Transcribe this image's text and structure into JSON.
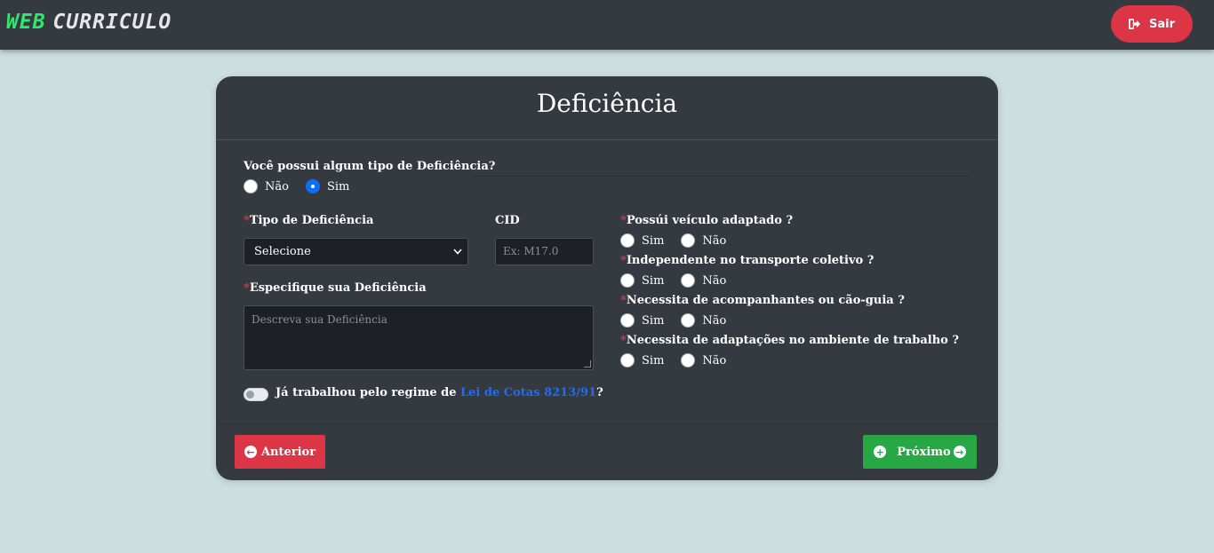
{
  "app": {
    "brand_part1": "WEB",
    "brand_part2": "CURRICULO",
    "logout_label": "Sair"
  },
  "card": {
    "title": "Deficiência",
    "question": "Você possui algum tipo de Deficiência?",
    "question_options": [
      {
        "label": "Não",
        "checked": false
      },
      {
        "label": "Sim",
        "checked": true
      }
    ],
    "tipo_label": "Tipo de Deficiência",
    "tipo_select_value": "Selecione",
    "cid_label": "CID",
    "cid_placeholder": "Ex: M17.0",
    "especifique_label": "Especifique sua Deficiência",
    "especifique_placeholder": "Descreva sua Deficiência",
    "required_mark": "*",
    "lei_prefix": "Já trabalhou pelo regime de ",
    "lei_link": "Lei de Cotas 8213/91",
    "lei_suffix": "?",
    "right_questions": [
      {
        "label": "Possúi veículo adaptado ?",
        "yes": "Sim",
        "no": "Não"
      },
      {
        "label": "Independente no transporte coletivo ?",
        "yes": "Sim",
        "no": "Não"
      },
      {
        "label": "Necessita de acompanhantes ou cão-guia ?",
        "yes": "Sim",
        "no": "Não"
      },
      {
        "label": "Necessita de adaptações no ambiente de trabalho ?",
        "yes": "Sim",
        "no": "Não"
      }
    ],
    "prev_label": "Anterior",
    "next_label": "Próximo"
  },
  "colors": {
    "background": "#cbdfdf",
    "navbar": "#343a40",
    "danger": "#dc3545",
    "success": "#28a745",
    "link": "#1b6ef5",
    "brand_green": "#2ee86b"
  }
}
